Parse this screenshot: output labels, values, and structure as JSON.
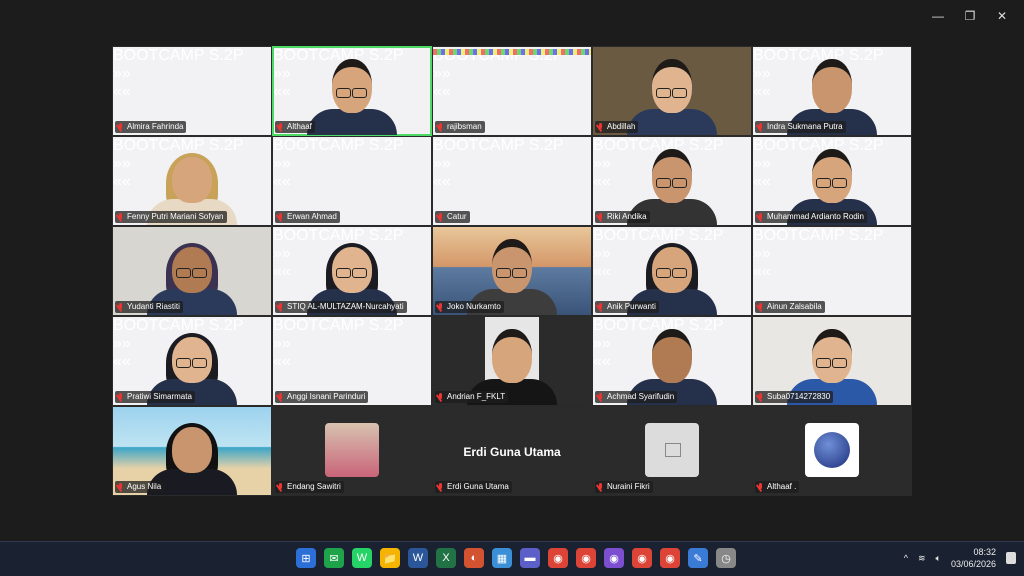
{
  "window": {
    "minimize": "—",
    "restore": "❐",
    "close": "✕"
  },
  "participants": [
    {
      "name": "Almira Fahrinda",
      "type": "slide"
    },
    {
      "name": "Althaaf",
      "type": "slide-person",
      "active": true
    },
    {
      "name": "rajibsman",
      "type": "slide-lights"
    },
    {
      "name": "Abdillah",
      "type": "person-room"
    },
    {
      "name": "Indra Sukmana Putra",
      "type": "slide-person"
    },
    {
      "name": "Fenny Putri Mariani Sofyan",
      "type": "slide-avatar"
    },
    {
      "name": "Erwan Ahmad",
      "type": "slide"
    },
    {
      "name": "Catur",
      "type": "slide"
    },
    {
      "name": "Riki Andika",
      "type": "slide-avatar"
    },
    {
      "name": "Muhammad Ardianto Rodin",
      "type": "slide-person"
    },
    {
      "name": "Yudanti Riastiti",
      "type": "person-room"
    },
    {
      "name": "STIQ AL-MULTAZAM-Nurcahyati",
      "type": "slide-person"
    },
    {
      "name": "Joko Nurkamto",
      "type": "person-bridge"
    },
    {
      "name": "Anik Purwanti",
      "type": "slide-person"
    },
    {
      "name": "Ainun Zalsabila",
      "type": "slide"
    },
    {
      "name": "Pratiwi Simarmata",
      "type": "slide-person"
    },
    {
      "name": "Anggi Isnani Parinduri",
      "type": "slide"
    },
    {
      "name": "Andrian F_FKLT",
      "type": "person-dark"
    },
    {
      "name": "Achmad Syarifudin",
      "type": "slide-person"
    },
    {
      "name": "Suba0714272830",
      "type": "person-room"
    },
    {
      "name": "Agus Nila",
      "type": "person-beach"
    },
    {
      "name": "Endang Sawitri",
      "type": "avatar-photo"
    },
    {
      "name": "Erdi Guna Utama",
      "type": "name-only",
      "big_name": "Erdi Guna Utama"
    },
    {
      "name": "Nuraini Fikri",
      "type": "avatar-blank"
    },
    {
      "name": "Althaaf .",
      "type": "avatar-blueberry"
    }
  ],
  "slide": {
    "boot": "BOOTCAMP S.2P",
    "chev_l": "»»",
    "chev_r": "««"
  },
  "taskbar": {
    "icons": [
      "⊞",
      "✉",
      "W",
      "📁",
      "W",
      "X",
      "◐",
      "▦",
      "▬",
      "◉",
      "◉",
      "◉",
      "◉",
      "◉",
      "✎",
      "◷"
    ],
    "tray_chevron": "^",
    "time": "08:32",
    "date": "03/06/2026"
  },
  "colors": {
    "active_border": "#4cd964",
    "mic_off": "#e33333",
    "slide_accent": "#ee8a22",
    "boot": "#c02020"
  }
}
